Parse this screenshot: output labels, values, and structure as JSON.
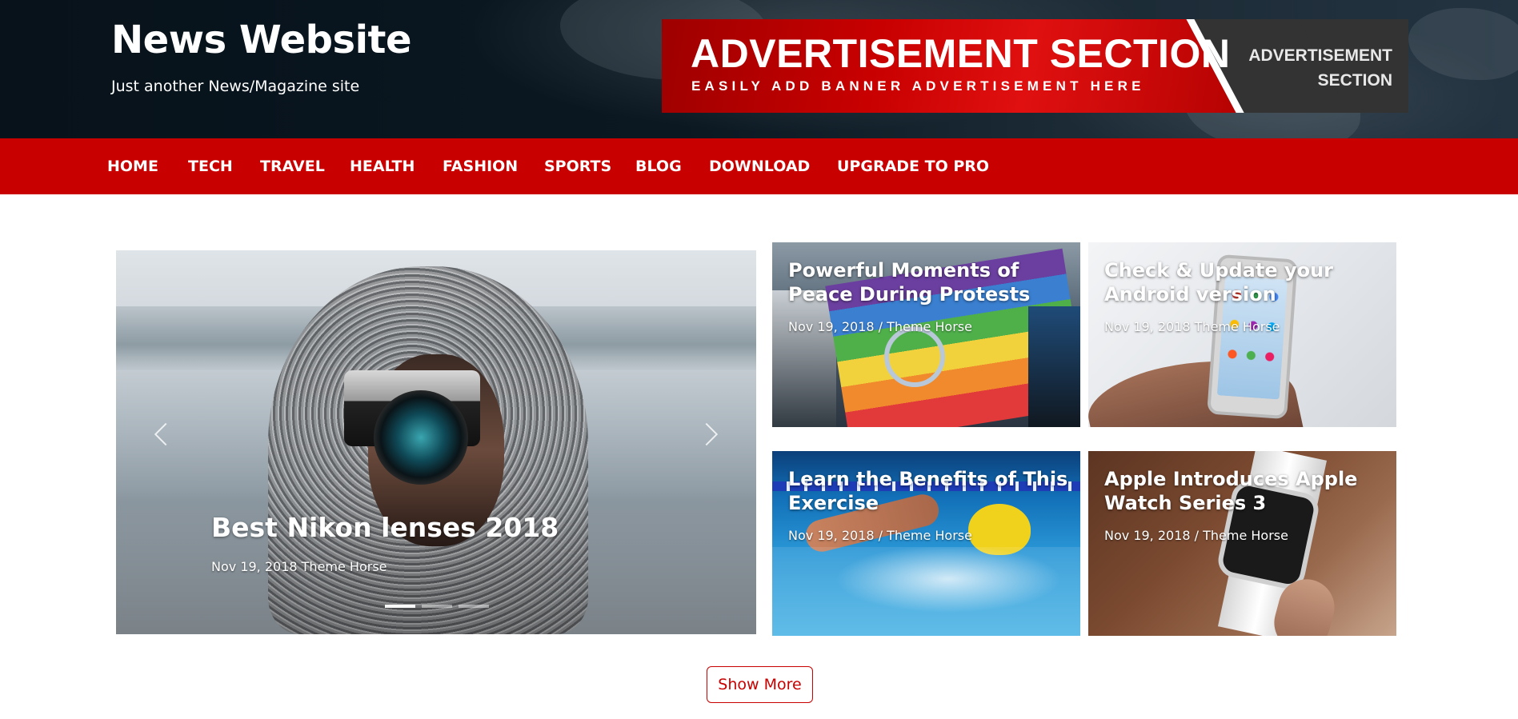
{
  "header": {
    "site_title": "News Website",
    "tagline": "Just another News/Magazine site",
    "ad": {
      "title": "ADVERTISEMENT SECTION",
      "subtitle": "EASILY ADD BANNER ADVERTISEMENT HERE",
      "side_line1": "ADVERTISEMENT",
      "side_line2": "SECTION"
    }
  },
  "nav": {
    "items": [
      "HOME",
      "TECH",
      "TRAVEL",
      "HEALTH",
      "FASHION",
      "SPORTS",
      "BLOG",
      "DOWNLOAD",
      "UPGRADE TO PRO"
    ]
  },
  "slider": {
    "title": "Best Nikon lenses 2018",
    "meta": "Nov 19, 2018 Theme Horse",
    "slide_count": 3,
    "active_slide": 1
  },
  "cards": [
    {
      "title": "Powerful Moments of Peace During Protests",
      "meta": "Nov 19, 2018 / Theme Horse"
    },
    {
      "title": "Check & Update your Android version",
      "meta": "Nov 19, 2018 Theme Horse"
    },
    {
      "title": "Learn the Benefits of This Exercise",
      "meta": "Nov 19, 2018 / Theme Horse"
    },
    {
      "title": "Apple Introduces Apple Watch Series 3",
      "meta": "Nov 19, 2018 / Theme Horse"
    }
  ],
  "show_more_label": "Show More",
  "colors": {
    "brand_red": "#c80000",
    "header_dark": "#0b1822",
    "text_white": "#ffffff"
  }
}
